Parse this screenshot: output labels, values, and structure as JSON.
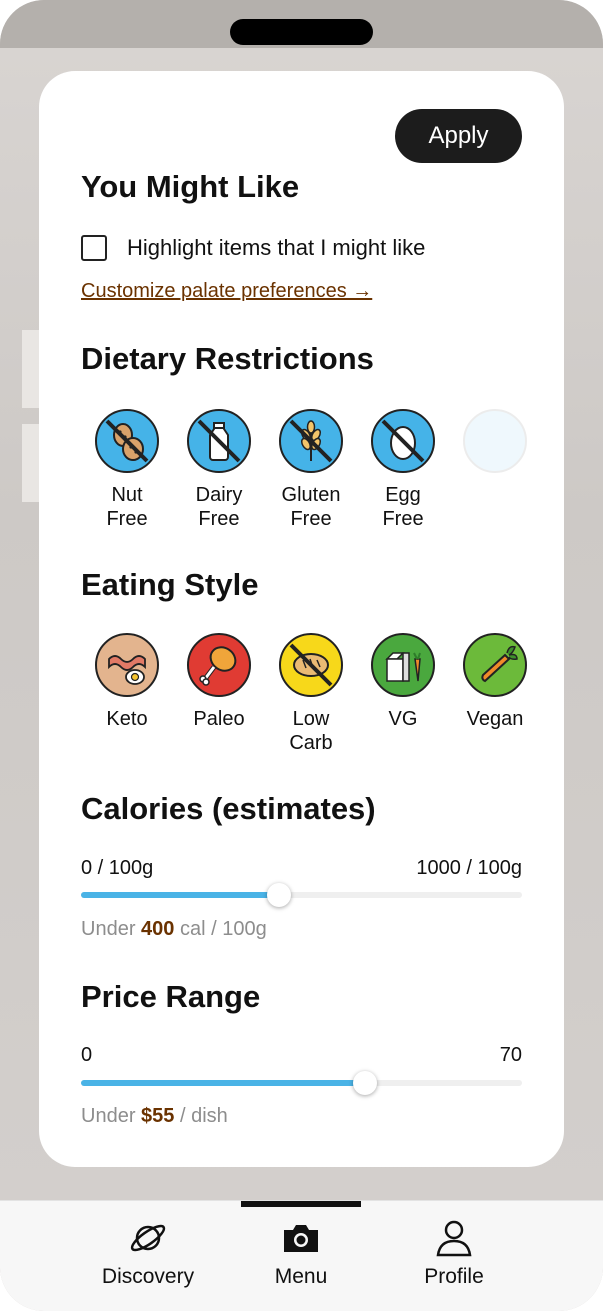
{
  "modal": {
    "apply_label": "Apply",
    "you_might_like": {
      "title": "You Might Like",
      "checkbox_label": "Highlight items that I might like",
      "checked": false,
      "link_label": "Customize palate preferences →"
    },
    "dietary": {
      "title": "Dietary Restrictions",
      "items": [
        {
          "line1": "Nut",
          "line2": "Free",
          "icon": "nut-free-icon"
        },
        {
          "line1": "Dairy",
          "line2": "Free",
          "icon": "dairy-free-icon"
        },
        {
          "line1": "Gluten",
          "line2": "Free",
          "icon": "gluten-free-icon"
        },
        {
          "line1": "Egg",
          "line2": "Free",
          "icon": "egg-free-icon"
        }
      ]
    },
    "eating_style": {
      "title": "Eating Style",
      "items": [
        {
          "line1": "Keto",
          "line2": "",
          "icon": "keto-icon"
        },
        {
          "line1": "Paleo",
          "line2": "",
          "icon": "paleo-icon"
        },
        {
          "line1": "Low",
          "line2": "Carb",
          "icon": "low-carb-icon"
        },
        {
          "line1": "VG",
          "line2": "",
          "icon": "vegetarian-icon"
        },
        {
          "line1": "Vegan",
          "line2": "",
          "icon": "vegan-icon"
        }
      ]
    },
    "calories": {
      "title": "Calories (estimates)",
      "min_label": "0 / 100g",
      "max_label": "1000 / 100g",
      "value_fraction": 0.45,
      "hint_prefix": "Under ",
      "hint_value": "400",
      "hint_suffix": " cal / 100g"
    },
    "price": {
      "title": "Price Range",
      "min_label": "0",
      "max_label": "70",
      "value_fraction": 0.645,
      "hint_prefix": "Under ",
      "hint_value": "$55",
      "hint_suffix": " / dish"
    }
  },
  "tabbar": {
    "tabs": [
      {
        "label": "Discovery",
        "icon": "planet-icon"
      },
      {
        "label": "Menu",
        "icon": "camera-icon",
        "active": true
      },
      {
        "label": "Profile",
        "icon": "person-icon"
      }
    ]
  },
  "colors": {
    "accent": "#4ab3e6",
    "link": "#6a3200",
    "apply_bg": "#1c1c1c"
  }
}
